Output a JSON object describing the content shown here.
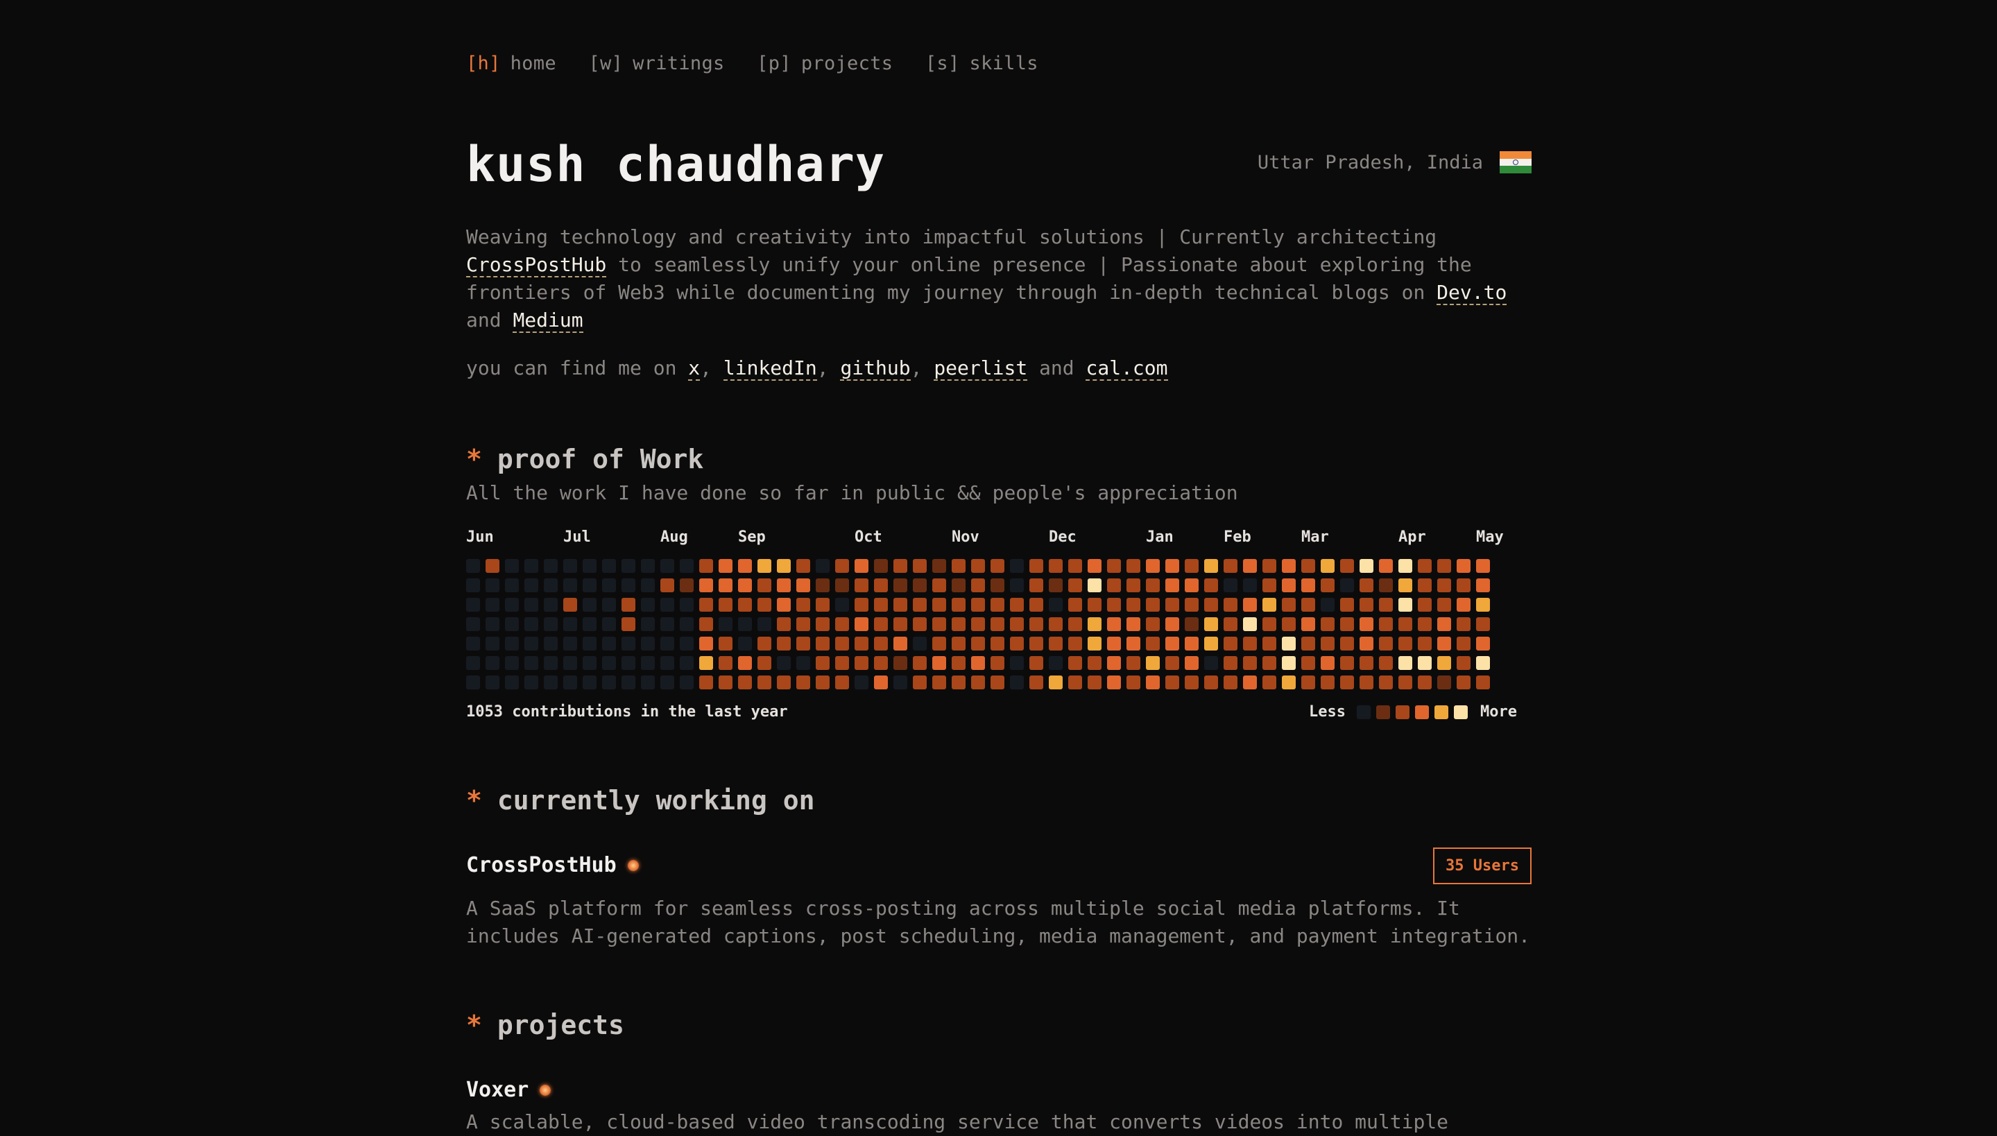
{
  "nav": [
    {
      "key": "[h]",
      "label": "home",
      "active": true
    },
    {
      "key": "[w]",
      "label": "writings",
      "active": false
    },
    {
      "key": "[p]",
      "label": "projects",
      "active": false
    },
    {
      "key": "[s]",
      "label": "skills",
      "active": false
    }
  ],
  "profile": {
    "name": "kush chaudhary",
    "location": "Uttar Pradesh, India",
    "bio_part1": "Weaving technology and creativity into impactful solutions | Currently architecting ",
    "bio_link1": "CrossPostHub",
    "bio_part2": " to seamlessly unify your online presence | Passionate about exploring the frontiers of Web3 while documenting my journey through in-depth technical blogs on ",
    "bio_link2": "Dev.to",
    "bio_part3": " and ",
    "bio_link3": "Medium",
    "find_prefix": "you can find me on ",
    "socials": [
      "x",
      "linkedIn",
      "github",
      "peerlist",
      "cal.com"
    ],
    "find_sep": ", ",
    "find_and": " and "
  },
  "proof": {
    "star": "*",
    "heading": "proof of Work",
    "subheading": "All the work I have done so far in public && people's appreciation",
    "months": [
      "Jun",
      "Jul",
      "Aug",
      "Sep",
      "Oct",
      "Nov",
      "Dec",
      "Jan",
      "Feb",
      "Mar",
      "Apr",
      "May"
    ],
    "contributions": "1053 contributions in the last year",
    "legend_less": "Less",
    "legend_more": "More",
    "levels": [
      "#161b22",
      "#6b2e12",
      "#a9461a",
      "#e0662e",
      "#f0a83a",
      "#fde2a8"
    ],
    "weeks": [
      [
        0,
        0,
        0,
        0,
        0,
        0,
        0
      ],
      [
        2,
        0,
        0,
        0,
        0,
        0,
        0
      ],
      [
        0,
        0,
        0,
        0,
        0,
        0,
        0
      ],
      [
        0,
        0,
        0,
        0,
        0,
        0,
        0
      ],
      [
        0,
        0,
        0,
        0,
        0,
        0,
        0
      ],
      [
        0,
        0,
        2,
        0,
        0,
        0,
        0
      ],
      [
        0,
        0,
        0,
        0,
        0,
        0,
        0
      ],
      [
        0,
        0,
        0,
        0,
        0,
        0,
        0
      ],
      [
        0,
        0,
        2,
        2,
        0,
        0,
        0
      ],
      [
        0,
        0,
        0,
        0,
        0,
        0,
        0
      ],
      [
        0,
        2,
        0,
        0,
        0,
        0,
        0
      ],
      [
        0,
        1,
        0,
        0,
        0,
        0,
        0
      ],
      [
        2,
        3,
        2,
        2,
        3,
        4,
        2
      ],
      [
        3,
        3,
        2,
        0,
        2,
        2,
        2
      ],
      [
        3,
        3,
        2,
        0,
        0,
        3,
        2
      ],
      [
        4,
        2,
        2,
        0,
        2,
        2,
        2
      ],
      [
        4,
        3,
        3,
        2,
        2,
        0,
        2
      ],
      [
        2,
        3,
        2,
        2,
        2,
        0,
        2
      ],
      [
        0,
        1,
        2,
        2,
        2,
        2,
        2
      ],
      [
        2,
        1,
        0,
        2,
        2,
        2,
        2
      ],
      [
        3,
        2,
        2,
        3,
        2,
        2,
        0
      ],
      [
        1,
        2,
        2,
        2,
        2,
        2,
        3
      ],
      [
        2,
        1,
        2,
        2,
        3,
        1,
        0
      ],
      [
        2,
        1,
        2,
        2,
        0,
        2,
        2
      ],
      [
        1,
        2,
        2,
        2,
        2,
        3,
        2
      ],
      [
        2,
        1,
        2,
        2,
        2,
        2,
        2
      ],
      [
        2,
        2,
        2,
        2,
        2,
        3,
        2
      ],
      [
        2,
        1,
        2,
        2,
        2,
        2,
        2
      ],
      [
        0,
        0,
        2,
        2,
        2,
        0,
        0
      ],
      [
        2,
        2,
        2,
        2,
        2,
        2,
        2
      ],
      [
        2,
        1,
        0,
        2,
        2,
        0,
        4
      ],
      [
        2,
        2,
        2,
        2,
        2,
        2,
        2
      ],
      [
        3,
        5,
        2,
        4,
        4,
        2,
        2
      ],
      [
        2,
        2,
        2,
        3,
        3,
        3,
        3
      ],
      [
        2,
        2,
        2,
        3,
        3,
        2,
        2
      ],
      [
        3,
        2,
        2,
        2,
        2,
        4,
        3
      ],
      [
        3,
        3,
        2,
        3,
        3,
        2,
        2
      ],
      [
        2,
        3,
        2,
        1,
        3,
        3,
        2
      ],
      [
        4,
        2,
        2,
        4,
        4,
        0,
        2
      ],
      [
        2,
        0,
        2,
        2,
        2,
        2,
        2
      ],
      [
        3,
        0,
        3,
        5,
        2,
        2,
        3
      ],
      [
        2,
        2,
        4,
        2,
        2,
        2,
        2
      ],
      [
        3,
        3,
        2,
        2,
        5,
        5,
        4
      ],
      [
        2,
        3,
        2,
        3,
        2,
        2,
        2
      ],
      [
        4,
        2,
        0,
        2,
        2,
        3,
        2
      ],
      [
        2,
        0,
        2,
        2,
        2,
        2,
        2
      ],
      [
        5,
        2,
        2,
        3,
        3,
        2,
        2
      ],
      [
        3,
        1,
        2,
        2,
        2,
        2,
        2
      ],
      [
        5,
        4,
        5,
        2,
        2,
        5,
        2
      ],
      [
        2,
        2,
        2,
        2,
        2,
        5,
        2
      ],
      [
        2,
        2,
        2,
        3,
        3,
        4,
        1
      ],
      [
        3,
        2,
        3,
        2,
        2,
        2,
        2
      ],
      [
        3,
        3,
        4,
        2,
        3,
        5,
        2
      ]
    ]
  },
  "working": {
    "star": "*",
    "heading": "currently working on",
    "project_name": "CrossPostHub",
    "badge": "35 Users",
    "description": "A SaaS platform for seamless cross-posting across multiple social media platforms. It includes AI-generated captions, post scheduling, media management, and payment integration."
  },
  "projects": {
    "star": "*",
    "heading": "projects",
    "items": [
      {
        "name": "Voxer",
        "description": "A scalable, cloud-based video transcoding service that converts videos into multiple"
      }
    ]
  },
  "colors": {
    "accent": "#e8773a",
    "background": "#0c0b0b",
    "text": "#8a8684",
    "heading": "#f2f0ee"
  }
}
